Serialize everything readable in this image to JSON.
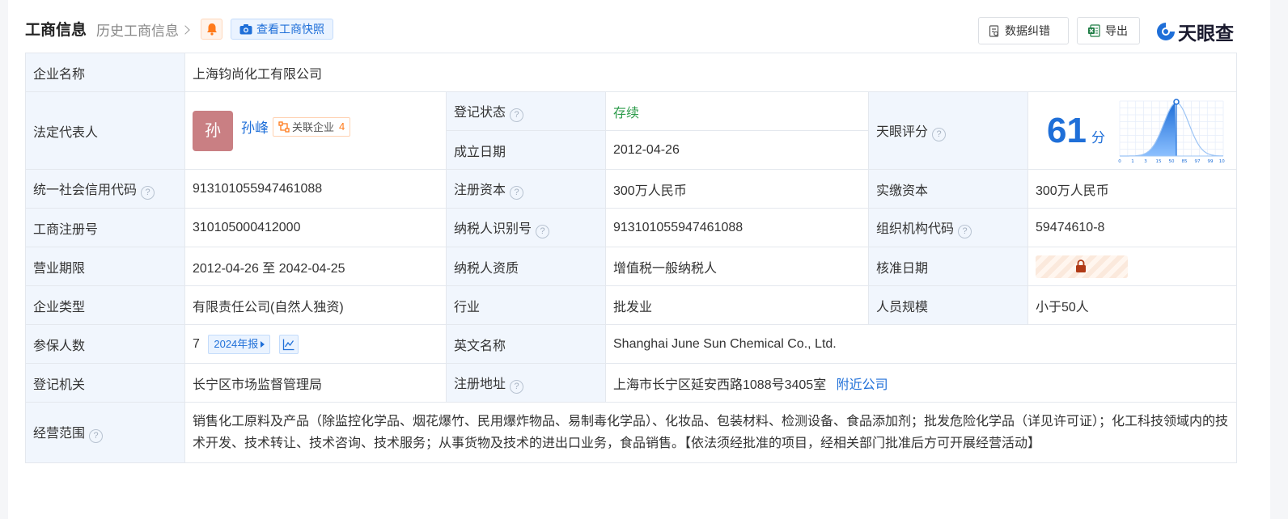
{
  "header": {
    "title": "工商信息",
    "history": "历史工商信息",
    "snapshot": "查看工商快照",
    "correct": "数据纠错",
    "export": "导出",
    "logo": "天眼查"
  },
  "rows": {
    "company_name_label": "企业名称",
    "company_name": "上海钧尚化工有限公司",
    "legal_label": "法定代表人",
    "legal_avatar": "孙",
    "legal_name": "孙峰",
    "related_label": "关联企业",
    "related_count": "4",
    "reg_status_label": "登记状态",
    "reg_status": "存续",
    "found_date_label": "成立日期",
    "found_date": "2012-04-26",
    "score_label": "天眼评分",
    "score": "61",
    "score_unit": "分",
    "credit_code_label": "统一社会信用代码",
    "credit_code": "913101055947461088",
    "reg_capital_label": "注册资本",
    "reg_capital": "300万人民币",
    "paid_capital_label": "实缴资本",
    "paid_capital": "300万人民币",
    "reg_no_label": "工商注册号",
    "reg_no": "310105000412000",
    "taxpayer_id_label": "纳税人识别号",
    "taxpayer_id": "913101055947461088",
    "org_code_label": "组织机构代码",
    "org_code": "59474610-8",
    "term_label": "营业期限",
    "term": "2012-04-26 至 2042-04-25",
    "tax_qual_label": "纳税人资质",
    "tax_qual": "增值税一般纳税人",
    "approve_label": "核准日期",
    "type_label": "企业类型",
    "type": "有限责任公司(自然人独资)",
    "industry_label": "行业",
    "industry": "批发业",
    "staff_label": "人员规模",
    "staff": "小于50人",
    "insured_label": "参保人数",
    "insured": "7",
    "insured_report": "2024年报",
    "english_label": "英文名称",
    "english": "Shanghai June Sun Chemical Co., Ltd.",
    "authority_label": "登记机关",
    "authority": "长宁区市场监督管理局",
    "address_label": "注册地址",
    "address": "上海市长宁区延安西路1088号3405室",
    "nearby": "附近公司",
    "scope_label": "经营范围",
    "scope": "销售化工原料及产品（除监控化学品、烟花爆竹、民用爆炸物品、易制毒化学品）、化妆品、包装材料、检测设备、食品添加剂；批发危险化学品（详见许可证）；化工科技领域内的技术开发、技术转让、技术咨询、技术服务；从事货物及技术的进出口业务，食品销售。【依法须经批准的项目，经相关部门批准后方可开展经营活动】"
  },
  "score_chart": {
    "ticks": [
      "0",
      "1",
      "3",
      "15",
      "50",
      "85",
      "97",
      "99",
      "100"
    ],
    "marker": 61
  },
  "colors": {
    "accent": "#1f6fd8",
    "label_bg": "#f1f6fd",
    "status_green": "#2c9b4a",
    "orange": "#ff7a1a"
  },
  "icons": {
    "bell": "bell-icon",
    "camera": "camera-icon",
    "correct": "document-edit-icon",
    "excel": "excel-icon",
    "lock": "lock-icon",
    "trend": "trend-chart-icon",
    "related": "related-network-icon"
  }
}
